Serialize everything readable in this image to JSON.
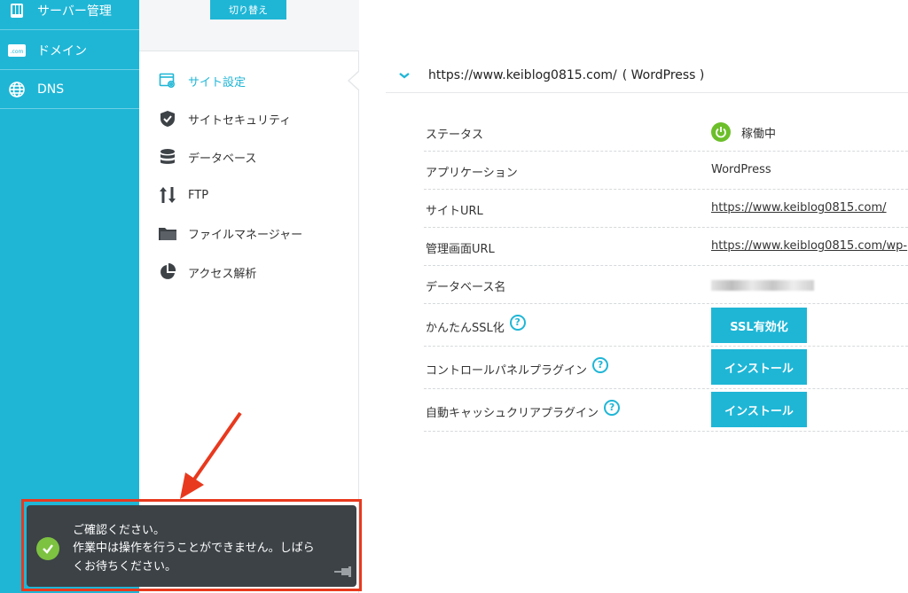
{
  "sidebar": {
    "items": [
      {
        "label": "サーバー管理",
        "icon": "server-icon"
      },
      {
        "label": "ドメイン",
        "icon": "domain-icon"
      },
      {
        "label": "DNS",
        "icon": "globe-icon"
      }
    ]
  },
  "submenu": {
    "switch_label": "切り替え",
    "items": [
      {
        "label": "サイト設定",
        "icon": "site-settings-icon",
        "active": true
      },
      {
        "label": "サイトセキュリティ",
        "icon": "shield-icon"
      },
      {
        "label": "データベース",
        "icon": "database-icon"
      },
      {
        "label": "FTP",
        "icon": "ftp-arrows-icon"
      },
      {
        "label": "ファイルマネージャー",
        "icon": "folder-icon"
      },
      {
        "label": "アクセス解析",
        "icon": "pie-chart-icon"
      }
    ]
  },
  "site": {
    "url": "https://www.keiblog0815.com/",
    "app_suffix": "( WordPress )"
  },
  "details": {
    "status_label": "ステータス",
    "status_value": "稼働中",
    "application_label": "アプリケーション",
    "application_value": "WordPress",
    "site_url_label": "サイトURL",
    "site_url_value": "https://www.keiblog0815.com/",
    "admin_url_label": "管理画面URL",
    "admin_url_value": "https://www.keiblog0815.com/wp-",
    "db_name_label": "データベース名",
    "ssl_label": "かんたんSSL化",
    "ssl_button": "SSL有効化",
    "cp_plugin_label": "コントロールパネルプラグイン",
    "cp_plugin_button": "インストール",
    "cache_plugin_label": "自動キャッシュクリアプラグイン",
    "cache_plugin_button": "インストール",
    "help_glyph": "?"
  },
  "toast": {
    "title": "ご確認ください。",
    "message": "作業中は操作を行うことができません。しばらくお待ちください。"
  },
  "colors": {
    "accent": "#1fb6d6",
    "status_green": "#6cbf2a",
    "toast_bg": "#3c4246",
    "highlight_red": "#e8391e"
  }
}
